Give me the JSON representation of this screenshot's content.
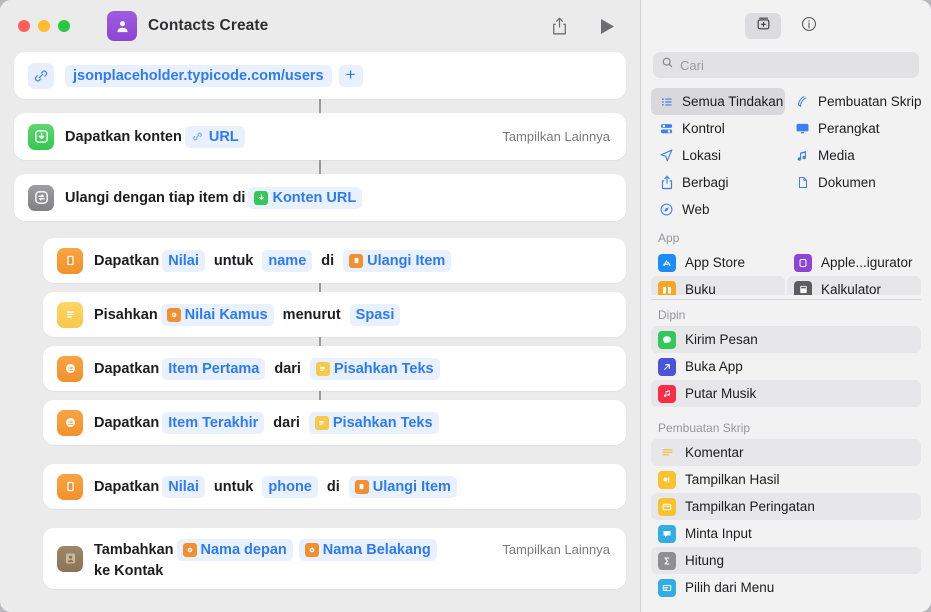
{
  "window": {
    "title": "Contacts Create",
    "app_icon": "contacts-person-icon",
    "share_icon": "share-icon",
    "run_icon": "play-icon",
    "traffic_lights": [
      "close",
      "minimize",
      "zoom"
    ]
  },
  "workflow": {
    "rows": [
      {
        "id": "url-action",
        "icon": "link-icon",
        "icon_style": "url",
        "url_value": "jsonplaceholder.typicode.com/users",
        "add_label": "+",
        "more_label": ""
      },
      {
        "id": "get-contents-of-url",
        "icon": "download-box-icon",
        "icon_style": "green",
        "text1": "Dapatkan konten",
        "chip1": "URL",
        "chip1_icon": "link-icon",
        "more_label": "Tampilkan Lainnya"
      },
      {
        "id": "repeat-with-each",
        "icon": "repeat-arrows-icon",
        "icon_style": "gray",
        "text1": "Ulangi dengan tiap item di",
        "chip1": "Konten URL",
        "chip1_icon": "green-download-icon",
        "more_label": ""
      },
      {
        "id": "get-value-name",
        "icon": "dictionary-book-icon",
        "icon_style": "orange",
        "text1": "Dapatkan",
        "chip1": "Nilai",
        "text2": "untuk",
        "chip2": "name",
        "text3": "di",
        "chip3": "Ulangi Item",
        "chip3_icon": "repeat-item-icon",
        "more_label": ""
      },
      {
        "id": "split-text",
        "icon": "text-lines-icon",
        "icon_style": "yellow",
        "text1": "Pisahkan",
        "chip1": "Nilai Kamus",
        "chip1_icon": "orange-dictionary-icon",
        "text2": "menurut",
        "chip2": "Spasi",
        "more_label": ""
      },
      {
        "id": "get-first-item",
        "icon": "list-item-icon",
        "icon_style": "orange",
        "text1": "Dapatkan",
        "chip1": "Item Pertama",
        "text2": "dari",
        "chip2": "Pisahkan Teks",
        "chip2_icon": "yellow-text-icon",
        "more_label": ""
      },
      {
        "id": "get-last-item",
        "icon": "list-item-icon",
        "icon_style": "orange",
        "text1": "Dapatkan",
        "chip1": "Item Terakhir",
        "text2": "dari",
        "chip2": "Pisahkan Teks",
        "chip2_icon": "yellow-text-icon",
        "more_label": ""
      },
      {
        "id": "get-value-phone",
        "icon": "dictionary-book-icon",
        "icon_style": "orange",
        "text1": "Dapatkan",
        "chip1": "Nilai",
        "text2": "untuk",
        "chip2": "phone",
        "text3": "di",
        "chip3": "Ulangi Item",
        "chip3_icon": "repeat-item-icon",
        "more_label": ""
      },
      {
        "id": "add-to-contacts",
        "icon": "contacts-card-icon",
        "icon_style": "brown",
        "text1": "Tambahkan",
        "chip1": "Nama depan",
        "chip1_icon": "orange-dictionary-icon",
        "chip2": "Nama Belakang",
        "chip2_icon": "orange-dictionary-icon",
        "text_line2": "ke Kontak",
        "more_label": "Tampilkan Lainnya"
      }
    ]
  },
  "library": {
    "toolbar": {
      "actions_tab": "action-library-icon",
      "info_tab": "info-circle-icon"
    },
    "search": {
      "placeholder": "Cari",
      "value": "",
      "icon": "search-icon"
    },
    "categories": [
      {
        "label": "Semua Tindakan",
        "icon": "list-bullets-icon",
        "selected": true
      },
      {
        "label": "Pembuatan Skrip",
        "icon": "scripting-icon",
        "selected": false
      },
      {
        "label": "Kontrol",
        "icon": "sliders-icon",
        "selected": false
      },
      {
        "label": "Perangkat",
        "icon": "display-icon",
        "selected": false
      },
      {
        "label": "Lokasi",
        "icon": "location-arrow-icon",
        "selected": false
      },
      {
        "label": "Media",
        "icon": "music-note-icon",
        "selected": false
      },
      {
        "label": "Berbagi",
        "icon": "share-icon",
        "selected": false
      },
      {
        "label": "Dokumen",
        "icon": "document-icon",
        "selected": false
      },
      {
        "label": "Web",
        "icon": "safari-compass-icon",
        "selected": false
      }
    ],
    "sections": [
      {
        "header": "App",
        "two_column": true,
        "items": [
          {
            "label": "App Store",
            "icon": "app-store-icon",
            "color": "#1e8cf5",
            "alt": false
          },
          {
            "label": "Apple...igurator",
            "icon": "apple-configurator-icon",
            "color": "#8c45d6",
            "alt": false
          },
          {
            "label": "Buku",
            "icon": "books-icon",
            "color": "#f5a623",
            "alt": true
          },
          {
            "label": "Kalkulator",
            "icon": "calculator-icon",
            "color": "#5c5c60",
            "alt": true
          }
        ]
      },
      {
        "header": "Dipin",
        "two_column": false,
        "items": [
          {
            "label": "Kirim Pesan",
            "icon": "messages-icon",
            "color": "#34c759",
            "alt": true
          },
          {
            "label": "Buka App",
            "icon": "open-app-arrow-icon",
            "color": "#4a54d8",
            "alt": false
          },
          {
            "label": "Putar Musik",
            "icon": "music-app-icon",
            "color": "#fa2d48",
            "alt": true
          }
        ]
      },
      {
        "header": "Pembuatan Skrip",
        "two_column": false,
        "items": [
          {
            "label": "Komentar",
            "icon": "comment-lines-icon",
            "color": "#f4c44a",
            "alt": true
          },
          {
            "label": "Tampilkan Hasil",
            "icon": "show-result-icon",
            "color": "#f9c22e",
            "alt": false
          },
          {
            "label": "Tampilkan Peringatan",
            "icon": "show-alert-icon",
            "color": "#f9c22e",
            "alt": true
          },
          {
            "label": "Minta Input",
            "icon": "ask-input-icon",
            "color": "#32ade6",
            "alt": false
          },
          {
            "label": "Hitung",
            "icon": "calculate-sigma-icon",
            "color": "#8e8e93",
            "alt": true
          },
          {
            "label": "Pilih dari Menu",
            "icon": "choose-menu-icon",
            "color": "#32ade6",
            "alt": false
          }
        ]
      }
    ]
  },
  "colors": {
    "accent_blue": "#2d7bf4",
    "chip_bg": "#eaf1fe",
    "window_bg": "#ebebeb",
    "sidebar_bg": "#f2f2f2",
    "card_bg": "#ffffff"
  }
}
